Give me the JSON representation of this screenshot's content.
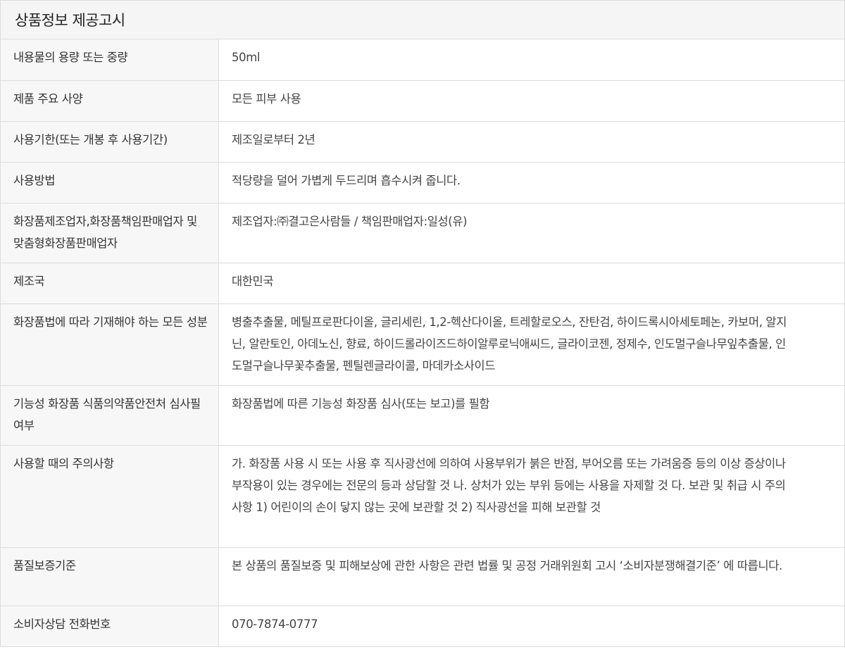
{
  "title": "상품정보 제공고시",
  "rows": [
    {
      "label": "내용물의 용량 또는 중량",
      "value": "50ml"
    },
    {
      "label": "제품 주요 사양",
      "value": "모든 피부 사용"
    },
    {
      "label": "사용기한(또는 개봉 후 사용기간)",
      "value": "제조일로부터 2년"
    },
    {
      "label": "사용방법",
      "value": "적당량을 덜어 가볍게 두드리며 흡수시켜 줍니다."
    },
    {
      "label": "화장품제조업자,화장품책임판매업자 및 맞춤형화장품판매업자",
      "value": "제조업자:㈜결고은사람들 / 책임판매업자:일성(유)"
    },
    {
      "label": "제조국",
      "value": "대한민국"
    },
    {
      "label": "화장품법에 따라 기재해야 하는 모든 성분",
      "value": "병출추출물, 메틸프로판다이올, 글리세린, 1,2-헥산다이올, 트레할로오스, 잔탄검, 하이드록시아세토페논, 카보머, 알지닌, 알란토인, 아데노신, 향료, 하이드롤라이즈드하이알루로닉애씨드, 글라이코젠, 정제수, 인도멀구슬나무잎추출물, 인도멀구슬나무꽃추출물, 펜틸렌글라이콜, 마데카소사이드"
    },
    {
      "label": "기능성 화장품 식품의약품안전처 심사필 여부",
      "value": "화장품법에 따른 기능성 화장품 심사(또는 보고)를 필함"
    },
    {
      "label": "사용할 때의 주의사항",
      "value": "가. 화장품 사용 시 또는 사용 후 직사광선에 의하여 사용부위가 붉은 반점, 부어오름 또는 가려움증 등의 이상 증상이나 부작용이 있는 경우에는 전문의 등과 상담할 것 나. 상처가 있는 부위 등에는 사용을 자제할 것 다. 보관 및 취급 시 주의사항 1) 어린이의 손이 닿지 않는 곳에 보관할 것 2) 직사광선을 피해 보관할 것"
    },
    {
      "label": "품질보증기준",
      "value": "본 상품의 품질보증 및 피해보상에 관한 사항은 관련 법률 및 공정 거래위원회 고시 ‘소비자분쟁해결기준’ 에 따릅니다."
    },
    {
      "label": "소비자상담 전화번호",
      "value": "070-7874-0777"
    }
  ]
}
